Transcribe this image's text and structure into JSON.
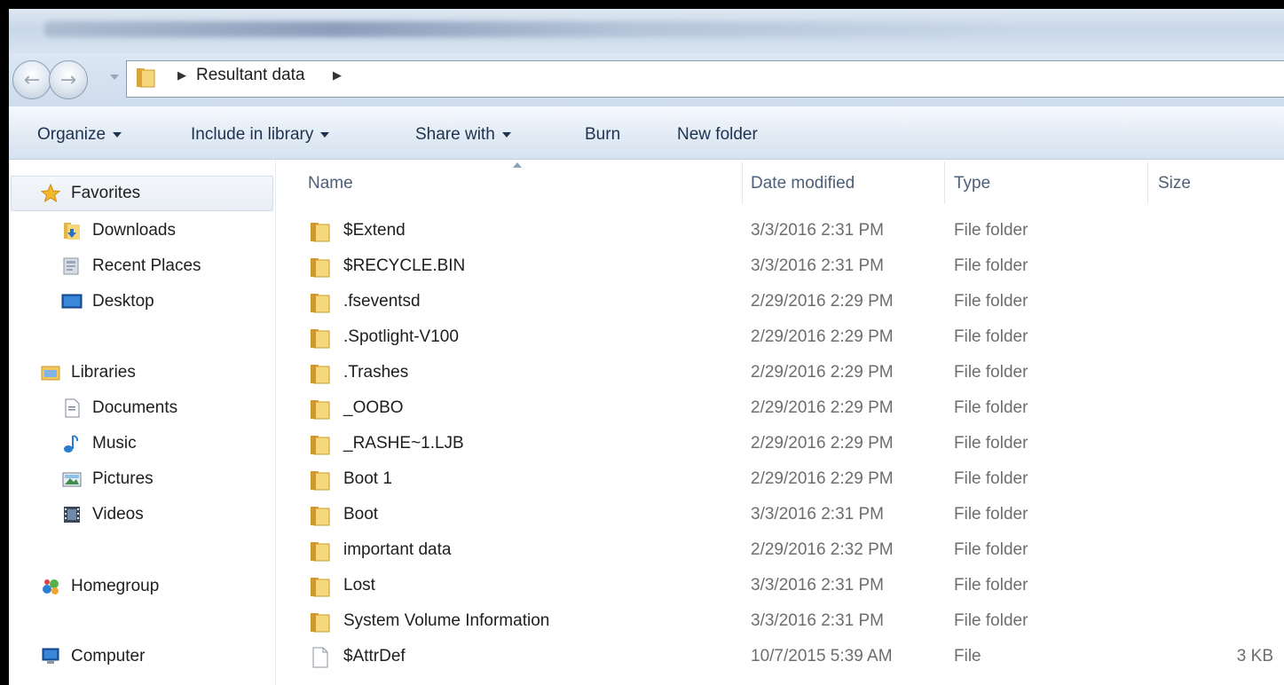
{
  "window": {
    "breadcrumb": [
      "Resultant data"
    ]
  },
  "toolbar": {
    "organize_label": "Organize",
    "include_label": "Include in library",
    "share_label": "Share with",
    "burn_label": "Burn",
    "new_folder_label": "New folder"
  },
  "sidebar": {
    "favorites": {
      "label": "Favorites",
      "icon": "star-icon"
    },
    "favorites_items": [
      {
        "label": "Downloads",
        "icon": "downloads-icon"
      },
      {
        "label": "Recent Places",
        "icon": "recent-places-icon"
      },
      {
        "label": "Desktop",
        "icon": "desktop-icon"
      }
    ],
    "libraries": {
      "label": "Libraries",
      "icon": "libraries-icon"
    },
    "library_items": [
      {
        "label": "Documents",
        "icon": "documents-icon"
      },
      {
        "label": "Music",
        "icon": "music-icon"
      },
      {
        "label": "Pictures",
        "icon": "pictures-icon"
      },
      {
        "label": "Videos",
        "icon": "videos-icon"
      }
    ],
    "homegroup": {
      "label": "Homegroup",
      "icon": "homegroup-icon"
    },
    "computer": {
      "label": "Computer",
      "icon": "computer-icon"
    }
  },
  "columns": {
    "name": "Name",
    "date": "Date modified",
    "type": "Type",
    "size": "Size"
  },
  "files": [
    {
      "name": "$Extend",
      "date": "3/3/2016 2:31 PM",
      "type": "File folder",
      "size": "",
      "icon": "folder-icon"
    },
    {
      "name": "$RECYCLE.BIN",
      "date": "3/3/2016 2:31 PM",
      "type": "File folder",
      "size": "",
      "icon": "folder-icon"
    },
    {
      "name": ".fseventsd",
      "date": "2/29/2016 2:29 PM",
      "type": "File folder",
      "size": "",
      "icon": "folder-icon"
    },
    {
      "name": ".Spotlight-V100",
      "date": "2/29/2016 2:29 PM",
      "type": "File folder",
      "size": "",
      "icon": "folder-icon"
    },
    {
      "name": ".Trashes",
      "date": "2/29/2016 2:29 PM",
      "type": "File folder",
      "size": "",
      "icon": "folder-icon"
    },
    {
      "name": "_OOBO",
      "date": "2/29/2016 2:29 PM",
      "type": "File folder",
      "size": "",
      "icon": "folder-icon"
    },
    {
      "name": "_RASHE~1.LJB",
      "date": "2/29/2016 2:29 PM",
      "type": "File folder",
      "size": "",
      "icon": "folder-icon"
    },
    {
      "name": "Boot 1",
      "date": "2/29/2016 2:29 PM",
      "type": "File folder",
      "size": "",
      "icon": "folder-icon"
    },
    {
      "name": "Boot",
      "date": "3/3/2016 2:31 PM",
      "type": "File folder",
      "size": "",
      "icon": "folder-icon"
    },
    {
      "name": "important data",
      "date": "2/29/2016 2:32 PM",
      "type": "File folder",
      "size": "",
      "icon": "folder-icon"
    },
    {
      "name": "Lost",
      "date": "3/3/2016 2:31 PM",
      "type": "File folder",
      "size": "",
      "icon": "folder-icon"
    },
    {
      "name": "System Volume Information",
      "date": "3/3/2016 2:31 PM",
      "type": "File folder",
      "size": "",
      "icon": "folder-icon"
    },
    {
      "name": "$AttrDef",
      "date": "10/7/2015 5:39 AM",
      "type": "File",
      "size": "3 KB",
      "icon": "file-icon"
    }
  ]
}
